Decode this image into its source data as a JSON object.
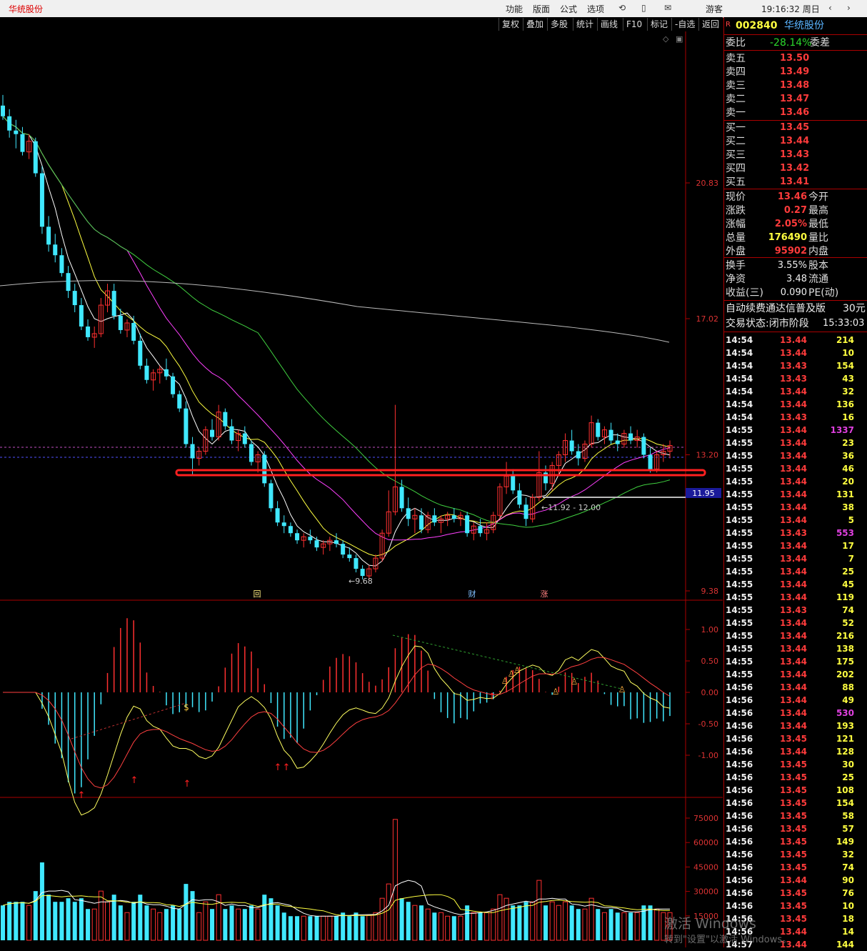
{
  "topbar": {
    "app_title": "华统股份",
    "menu": [
      "功能",
      "版面",
      "公式",
      "选项"
    ],
    "guest": "游客",
    "clock": "19:16:32 周日"
  },
  "toolbar": [
    "复权",
    "叠加",
    "多股",
    "统计",
    "画线",
    "F10",
    "标记",
    "-自选",
    "返回"
  ],
  "stock": {
    "code": "002840",
    "name": "华统股份",
    "badge": "R"
  },
  "quote": {
    "weibi_label": "委比",
    "weibi": "-28.14%",
    "weicha_label": "委差",
    "asks": [
      {
        "l": "卖五",
        "p": "13.50"
      },
      {
        "l": "卖四",
        "p": "13.49"
      },
      {
        "l": "卖三",
        "p": "13.48"
      },
      {
        "l": "卖二",
        "p": "13.47"
      },
      {
        "l": "卖一",
        "p": "13.46"
      }
    ],
    "bids": [
      {
        "l": "买一",
        "p": "13.45"
      },
      {
        "l": "买二",
        "p": "13.44"
      },
      {
        "l": "买三",
        "p": "13.43"
      },
      {
        "l": "买四",
        "p": "13.42"
      },
      {
        "l": "买五",
        "p": "13.41"
      }
    ],
    "stats": [
      {
        "l": "现价",
        "v": "13.46",
        "l2": "今开"
      },
      {
        "l": "涨跌",
        "v": "0.27",
        "l2": "最高"
      },
      {
        "l": "涨幅",
        "v": "2.05%",
        "l2": "最低"
      },
      {
        "l": "总量",
        "v": "176490",
        "l2": "量比"
      },
      {
        "l": "外盘",
        "v": "95902",
        "l2": "内盘"
      }
    ],
    "stats2": [
      {
        "l": "换手",
        "v": "3.55%",
        "l2": "股本"
      },
      {
        "l": "净资",
        "v": "3.48",
        "l2": "流通"
      },
      {
        "l": "收益(三)",
        "v": "0.090",
        "l2": "PE(动)"
      }
    ],
    "promo": "自动续费通达信普及版",
    "promo_price": "30元",
    "status": "交易状态:闭市阶段",
    "status_time": "15:33:03"
  },
  "ticks": [
    [
      "14:54",
      "13.44",
      "214"
    ],
    [
      "14:54",
      "13.44",
      "10"
    ],
    [
      "14:54",
      "13.43",
      "154"
    ],
    [
      "14:54",
      "13.43",
      "43"
    ],
    [
      "14:54",
      "13.44",
      "32"
    ],
    [
      "14:54",
      "13.44",
      "136"
    ],
    [
      "14:54",
      "13.43",
      "16"
    ],
    [
      "14:55",
      "13.44",
      "1337"
    ],
    [
      "14:55",
      "13.44",
      "23"
    ],
    [
      "14:55",
      "13.44",
      "36"
    ],
    [
      "14:55",
      "13.44",
      "46"
    ],
    [
      "14:55",
      "13.44",
      "20"
    ],
    [
      "14:55",
      "13.44",
      "131"
    ],
    [
      "14:55",
      "13.44",
      "38"
    ],
    [
      "14:55",
      "13.44",
      "5"
    ],
    [
      "14:55",
      "13.43",
      "553"
    ],
    [
      "14:55",
      "13.44",
      "17"
    ],
    [
      "14:55",
      "13.44",
      "7"
    ],
    [
      "14:55",
      "13.44",
      "25"
    ],
    [
      "14:55",
      "13.44",
      "45"
    ],
    [
      "14:55",
      "13.44",
      "119"
    ],
    [
      "14:55",
      "13.43",
      "74"
    ],
    [
      "14:55",
      "13.44",
      "52"
    ],
    [
      "14:55",
      "13.44",
      "216"
    ],
    [
      "14:55",
      "13.44",
      "138"
    ],
    [
      "14:55",
      "13.44",
      "175"
    ],
    [
      "14:55",
      "13.44",
      "202"
    ],
    [
      "14:56",
      "13.44",
      "88"
    ],
    [
      "14:56",
      "13.44",
      "49"
    ],
    [
      "14:56",
      "13.44",
      "530"
    ],
    [
      "14:56",
      "13.44",
      "193"
    ],
    [
      "14:56",
      "13.45",
      "121"
    ],
    [
      "14:56",
      "13.44",
      "128"
    ],
    [
      "14:56",
      "13.45",
      "30"
    ],
    [
      "14:56",
      "13.45",
      "25"
    ],
    [
      "14:56",
      "13.45",
      "108"
    ],
    [
      "14:56",
      "13.45",
      "154"
    ],
    [
      "14:56",
      "13.45",
      "58"
    ],
    [
      "14:56",
      "13.45",
      "57"
    ],
    [
      "14:56",
      "13.45",
      "149"
    ],
    [
      "14:56",
      "13.45",
      "32"
    ],
    [
      "14:56",
      "13.45",
      "74"
    ],
    [
      "14:56",
      "13.44",
      "90"
    ],
    [
      "14:56",
      "13.45",
      "76"
    ],
    [
      "14:56",
      "13.45",
      "10"
    ],
    [
      "14:56",
      "13.45",
      "18"
    ],
    [
      "14:56",
      "13.44",
      "14"
    ],
    [
      "14:57",
      "13.44",
      "144"
    ]
  ],
  "chart_data": {
    "type": "candlestick",
    "price_axis": [
      "20.83",
      "17.02",
      "13.20",
      "9.38"
    ],
    "price_ylim": [
      9.38,
      20.83
    ],
    "current_price_tag": "11.95",
    "low_label": "9.68",
    "range_label": "11.92 - 12.00",
    "markers": [
      "回",
      "财",
      "涨"
    ],
    "macd_axis": [
      "1.00",
      "0.50",
      "0.00",
      "-0.50",
      "-1.00"
    ],
    "volume_axis": [
      "75000",
      "60000",
      "45000",
      "30000",
      "15000"
    ],
    "candles": [
      [
        23.0,
        23.3,
        22.6,
        22.7
      ],
      [
        22.7,
        22.9,
        22.1,
        22.3
      ],
      [
        22.3,
        22.6,
        21.8,
        22.2
      ],
      [
        22.2,
        22.4,
        21.6,
        21.7
      ],
      [
        21.7,
        22.2,
        21.5,
        22.0
      ],
      [
        22.0,
        22.1,
        21.0,
        21.1
      ],
      [
        21.1,
        21.3,
        19.4,
        19.6
      ],
      [
        19.6,
        19.9,
        18.9,
        19.1
      ],
      [
        19.1,
        19.4,
        18.6,
        18.8
      ],
      [
        18.8,
        19.0,
        18.2,
        18.3
      ],
      [
        18.3,
        18.5,
        17.6,
        17.8
      ],
      [
        17.8,
        18.0,
        17.2,
        17.4
      ],
      [
        17.4,
        17.6,
        16.7,
        16.8
      ],
      [
        16.8,
        17.0,
        16.4,
        16.5
      ],
      [
        16.5,
        16.8,
        16.2,
        16.6
      ],
      [
        16.6,
        17.6,
        16.5,
        17.4
      ],
      [
        17.4,
        18.0,
        17.2,
        17.8
      ],
      [
        17.8,
        18.0,
        17.0,
        17.1
      ],
      [
        17.1,
        17.3,
        16.6,
        16.7
      ],
      [
        16.7,
        17.0,
        16.5,
        16.9
      ],
      [
        16.9,
        17.1,
        16.3,
        16.4
      ],
      [
        16.4,
        16.6,
        15.6,
        15.7
      ],
      [
        15.7,
        15.9,
        15.2,
        15.3
      ],
      [
        15.3,
        15.6,
        15.0,
        15.5
      ],
      [
        15.5,
        15.7,
        15.2,
        15.6
      ],
      [
        15.6,
        15.9,
        15.3,
        15.4
      ],
      [
        15.4,
        15.5,
        14.8,
        14.9
      ],
      [
        14.9,
        15.0,
        14.4,
        14.5
      ],
      [
        14.5,
        14.7,
        13.4,
        13.5
      ],
      [
        13.5,
        13.7,
        12.6,
        13.1
      ],
      [
        13.1,
        13.4,
        12.9,
        13.3
      ],
      [
        13.3,
        14.0,
        13.2,
        13.9
      ],
      [
        13.9,
        14.2,
        13.6,
        13.7
      ],
      [
        13.7,
        14.6,
        13.6,
        14.4
      ],
      [
        14.4,
        14.5,
        13.9,
        14.0
      ],
      [
        14.0,
        14.2,
        13.5,
        13.6
      ],
      [
        13.6,
        13.9,
        13.3,
        13.8
      ],
      [
        13.8,
        14.0,
        13.4,
        13.5
      ],
      [
        13.5,
        13.6,
        12.9,
        13.0
      ],
      [
        13.0,
        13.3,
        12.7,
        13.2
      ],
      [
        13.2,
        13.3,
        12.3,
        12.4
      ],
      [
        12.4,
        12.5,
        11.6,
        11.7
      ],
      [
        11.7,
        11.9,
        11.2,
        11.3
      ],
      [
        11.3,
        11.5,
        11.0,
        11.2
      ],
      [
        11.2,
        11.3,
        10.9,
        11.0
      ],
      [
        11.0,
        11.1,
        10.7,
        10.8
      ],
      [
        10.8,
        11.0,
        10.6,
        10.9
      ],
      [
        10.9,
        11.1,
        10.7,
        10.8
      ],
      [
        10.8,
        10.9,
        10.5,
        10.6
      ],
      [
        10.6,
        10.8,
        10.4,
        10.7
      ],
      [
        10.7,
        10.9,
        10.5,
        10.8
      ],
      [
        10.8,
        11.0,
        10.6,
        10.7
      ],
      [
        10.7,
        10.8,
        10.3,
        10.4
      ],
      [
        10.4,
        10.6,
        10.2,
        10.3
      ],
      [
        10.3,
        10.4,
        9.9,
        10.0
      ],
      [
        10.0,
        10.1,
        9.7,
        9.8
      ],
      [
        9.8,
        10.1,
        9.68,
        10.0
      ],
      [
        10.0,
        10.4,
        9.9,
        10.3
      ],
      [
        10.3,
        11.1,
        10.2,
        11.0
      ],
      [
        11.0,
        12.2,
        10.9,
        11.6
      ],
      [
        11.6,
        14.6,
        11.5,
        12.3
      ],
      [
        12.3,
        12.5,
        11.6,
        11.7
      ],
      [
        11.7,
        12.0,
        11.2,
        11.4
      ],
      [
        11.4,
        11.7,
        11.0,
        11.5
      ],
      [
        11.5,
        11.7,
        11.0,
        11.1
      ],
      [
        11.1,
        11.6,
        11.0,
        11.5
      ],
      [
        11.5,
        11.7,
        11.2,
        11.3
      ],
      [
        11.3,
        11.5,
        11.0,
        11.4
      ],
      [
        11.4,
        11.6,
        11.2,
        11.5
      ],
      [
        11.5,
        11.7,
        11.3,
        11.4
      ],
      [
        11.4,
        11.6,
        11.2,
        11.5
      ],
      [
        11.5,
        11.6,
        10.9,
        11.0
      ],
      [
        11.0,
        11.3,
        10.8,
        11.2
      ],
      [
        11.2,
        11.4,
        10.9,
        11.0
      ],
      [
        11.0,
        11.3,
        10.8,
        11.1
      ],
      [
        11.1,
        11.6,
        11.0,
        11.5
      ],
      [
        11.5,
        12.4,
        11.4,
        12.3
      ],
      [
        12.3,
        13.0,
        12.1,
        12.6
      ],
      [
        12.6,
        12.8,
        12.1,
        12.2
      ],
      [
        12.2,
        12.4,
        11.7,
        11.8
      ],
      [
        11.8,
        12.0,
        11.2,
        11.4
      ],
      [
        11.4,
        12.1,
        11.3,
        12.0
      ],
      [
        12.0,
        13.3,
        11.9,
        12.7
      ],
      [
        12.7,
        12.9,
        12.2,
        12.4
      ],
      [
        12.4,
        13.0,
        12.2,
        12.9
      ],
      [
        12.9,
        13.3,
        12.6,
        13.2
      ],
      [
        13.2,
        13.8,
        13.0,
        13.6
      ],
      [
        13.6,
        13.9,
        13.2,
        13.3
      ],
      [
        13.3,
        13.5,
        12.9,
        13.1
      ],
      [
        13.1,
        13.6,
        13.0,
        13.5
      ],
      [
        13.5,
        14.3,
        13.4,
        14.1
      ],
      [
        14.1,
        14.2,
        13.6,
        13.7
      ],
      [
        13.7,
        14.0,
        13.5,
        13.9
      ],
      [
        13.9,
        14.1,
        13.5,
        13.6
      ],
      [
        13.6,
        13.8,
        13.3,
        13.5
      ],
      [
        13.5,
        13.9,
        13.4,
        13.8
      ],
      [
        13.8,
        14.0,
        13.5,
        13.6
      ],
      [
        13.6,
        13.9,
        13.4,
        13.7
      ],
      [
        13.7,
        13.8,
        13.1,
        13.2
      ],
      [
        13.2,
        13.4,
        12.7,
        12.8
      ],
      [
        12.8,
        13.3,
        12.7,
        13.2
      ],
      [
        13.2,
        13.5,
        13.0,
        13.3
      ],
      [
        13.3,
        13.6,
        13.1,
        13.46
      ]
    ]
  }
}
